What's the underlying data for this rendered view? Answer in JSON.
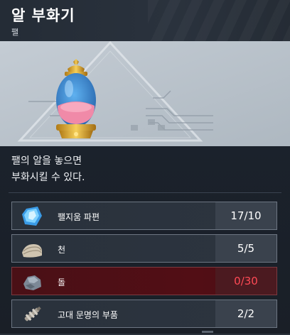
{
  "header": {
    "title": "알 부화기",
    "category": "팰"
  },
  "preview": {
    "item_icon": "egg-incubator-icon"
  },
  "description": {
    "lines": [
      "팰의 알을 놓으면",
      "부화시킬 수 있다."
    ]
  },
  "materials": [
    {
      "name": "팰지움 파편",
      "icon": "paldium-fragment-icon",
      "quantity": "17/10",
      "status": "sufficient"
    },
    {
      "name": "천",
      "icon": "cloth-icon",
      "quantity": "5/5",
      "status": "sufficient"
    },
    {
      "name": "돌",
      "icon": "stone-icon",
      "quantity": "0/30",
      "status": "insufficient"
    },
    {
      "name": "고대 문명의 부품",
      "icon": "ancient-civilization-parts-icon",
      "quantity": "2/2",
      "status": "sufficient"
    }
  ],
  "colors": {
    "insufficient_text": "#ff4a55",
    "insufficient_bg": "#4a1016",
    "panel_bg": "#1a2029"
  }
}
